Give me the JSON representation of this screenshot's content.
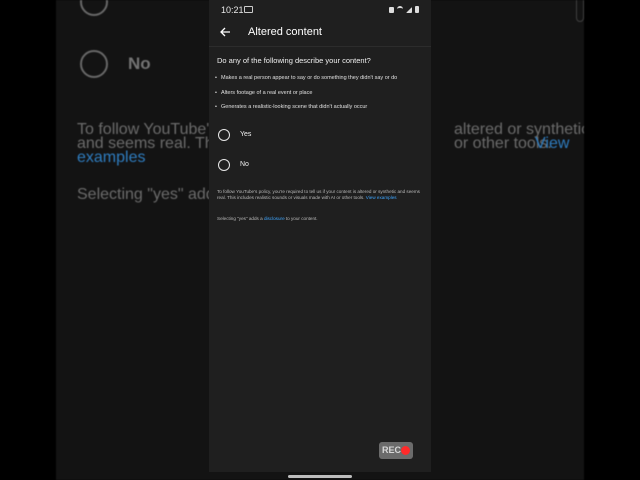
{
  "background": {
    "no_label": "No",
    "para1_left": "To follow YouTube's",
    "para1_left2": "and seems real. This",
    "para1_link": "examples",
    "para1_right": "altered or synthetic",
    "para1_right2": "or other tools.",
    "para1_right_link": "View",
    "para2": "Selecting \"yes\" adds"
  },
  "status_bar": {
    "time": "10:21"
  },
  "header": {
    "back_icon": "arrow-left-icon",
    "title": "Altered content"
  },
  "question": "Do any of the following describe your content?",
  "bullets": [
    "Makes a real person appear to say or do something they didn't say or do",
    "Alters footage of a real event or place",
    "Generates a realistic-looking scene that didn't actually occur"
  ],
  "options": [
    {
      "label": "Yes",
      "selected": false
    },
    {
      "label": "No",
      "selected": false
    }
  ],
  "policy_note": {
    "text": "To follow YouTube's policy, you're required to tell us if your content is altered or synthetic and seems real. This includes realistic sounds or visuals made with AI or other tools.",
    "link": "View examples"
  },
  "disclosure_note": {
    "prefix": "Selecting \"yes\" adds a",
    "link": "disclosure",
    "suffix": "to your content."
  },
  "rec_badge": "REC",
  "colors": {
    "link": "#3ea6ff",
    "rec_dot": "#ff2a2a",
    "surface": "#1f1f1f"
  }
}
